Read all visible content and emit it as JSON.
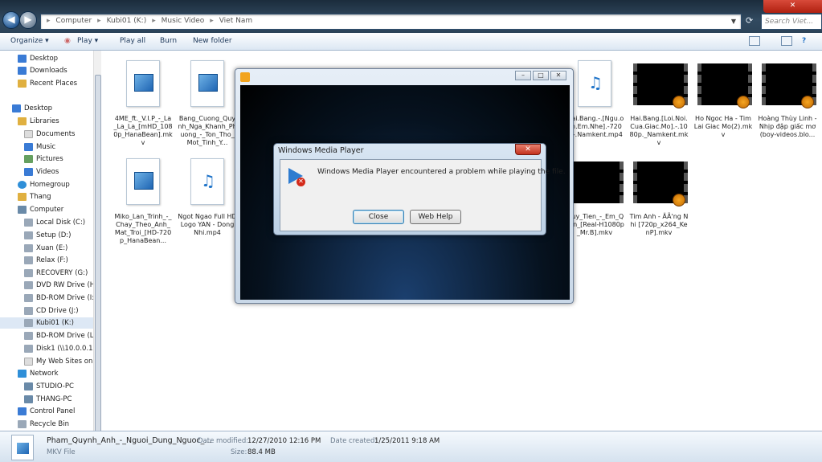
{
  "window": {
    "breadcrumbs": [
      "Computer",
      "Kubi01 (K:)",
      "Music Video",
      "Viet Nam"
    ],
    "search_placeholder": "Search Viet..."
  },
  "toolbar": {
    "organize": "Organize ▾",
    "play": "Play ▾",
    "play_all": "Play all",
    "burn": "Burn",
    "new_folder": "New folder"
  },
  "nav": {
    "items": [
      {
        "label": "Desktop",
        "color": "#3a7bd5"
      },
      {
        "label": "Downloads",
        "color": "#3a7bd5"
      },
      {
        "label": "Recent Places",
        "color": "#e0b040"
      },
      {
        "label": "Desktop",
        "color": "#3a7bd5"
      },
      {
        "label": "Libraries",
        "color": "#e0b040"
      },
      {
        "label": "Documents",
        "color": "#dddddd"
      },
      {
        "label": "Music",
        "color": "#3a7bd5"
      },
      {
        "label": "Pictures",
        "color": "#66a060"
      },
      {
        "label": "Videos",
        "color": "#3a7bd5"
      },
      {
        "label": "Homegroup",
        "color": "#2f8fd8"
      },
      {
        "label": "Thang",
        "color": "#e0b040"
      },
      {
        "label": "Computer",
        "color": "#6a8aa8"
      },
      {
        "label": "Local Disk (C:)",
        "color": "#9aa8b8"
      },
      {
        "label": "Setup (D:)",
        "color": "#9aa8b8"
      },
      {
        "label": "Xuan (E:)",
        "color": "#9aa8b8"
      },
      {
        "label": "Relax (F:)",
        "color": "#9aa8b8"
      },
      {
        "label": "RECOVERY (G:)",
        "color": "#9aa8b8"
      },
      {
        "label": "DVD RW Drive (H",
        "color": "#9aa8b8"
      },
      {
        "label": "BD-ROM Drive (I:",
        "color": "#9aa8b8"
      },
      {
        "label": "CD Drive (J:)",
        "color": "#9aa8b8"
      },
      {
        "label": "Kubi01 (K:)",
        "color": "#9aa8b8"
      },
      {
        "label": "BD-ROM Drive (L",
        "color": "#9aa8b8"
      },
      {
        "label": "Disk1 (\\\\10.0.0.1)",
        "color": "#9aa8b8"
      },
      {
        "label": "My Web Sites on",
        "color": "#dddddd"
      },
      {
        "label": "Network",
        "color": "#2f8fd8"
      },
      {
        "label": "STUDIO-PC",
        "color": "#6a8aa8"
      },
      {
        "label": "THANG-PC",
        "color": "#6a8aa8"
      },
      {
        "label": "Control Panel",
        "color": "#3a7bd5"
      },
      {
        "label": "Recycle Bin",
        "color": "#9aa8b8"
      }
    ]
  },
  "files": [
    {
      "name": "4ME_ft._V.I.P_-_La_La_La_[mHD_1080p_HanaBean].mkv",
      "type": "video-doc"
    },
    {
      "name": "Bang_Cuong_Quynh_Nga_Khanh_Phuong_-_Ton_Tho_Mot_Tinh_Y...",
      "type": "video-doc"
    },
    {
      "name": "...ai.Bang.-.[Ngu.oan.Em.Nhe].-720p.-.Namkent.mp4",
      "type": "audio-doc"
    },
    {
      "name": "Hai.Bang.[Loi.Noi.Cua.Giac.Mo].-.1080p._Namkent.mkv",
      "type": "video-thumb"
    },
    {
      "name": "Ho Ngoc Ha - Tim Lai Giac Mo(2).mkv",
      "type": "video-thumb"
    },
    {
      "name": "Hoàng Thùy Linh - Nhịp đập giấc mơ (boy-videos.blo...",
      "type": "video-thumb"
    },
    {
      "name": "Miko_Lan_Trinh_-_Chay_Theo_Anh_Mat_Troi_[HD-720p_HanaBean...",
      "type": "video-doc"
    },
    {
      "name": "Ngot Ngao Full HD Logo YAN - Dong Nhi.mp4",
      "type": "audio-doc"
    },
    {
      "name": "...uy_Tien_-_Em_Quen_[Real-H1080p_Mr.B].mkv",
      "type": "video-thumb"
    },
    {
      "name": "Tim Anh - ÄÃ'ng Nhi [720p_x264_KenP].mkv",
      "type": "video-thumb"
    }
  ],
  "wmp": {
    "dialog_title": "Windows Media Player",
    "message": "Windows Media Player encountered a problem while playing the file.",
    "close_label": "Close",
    "help_label": "Web Help"
  },
  "details": {
    "filename": "Pham_Quynh_Anh_-_Nguoi_Dung_Nguoc_...",
    "filetype": "MKV File",
    "modified_label": "Date modified:",
    "modified_value": "12/27/2010 12:16 PM",
    "size_label": "Size:",
    "size_value": "88.4 MB",
    "created_label": "Date created:",
    "created_value": "1/25/2011 9:18 AM"
  }
}
